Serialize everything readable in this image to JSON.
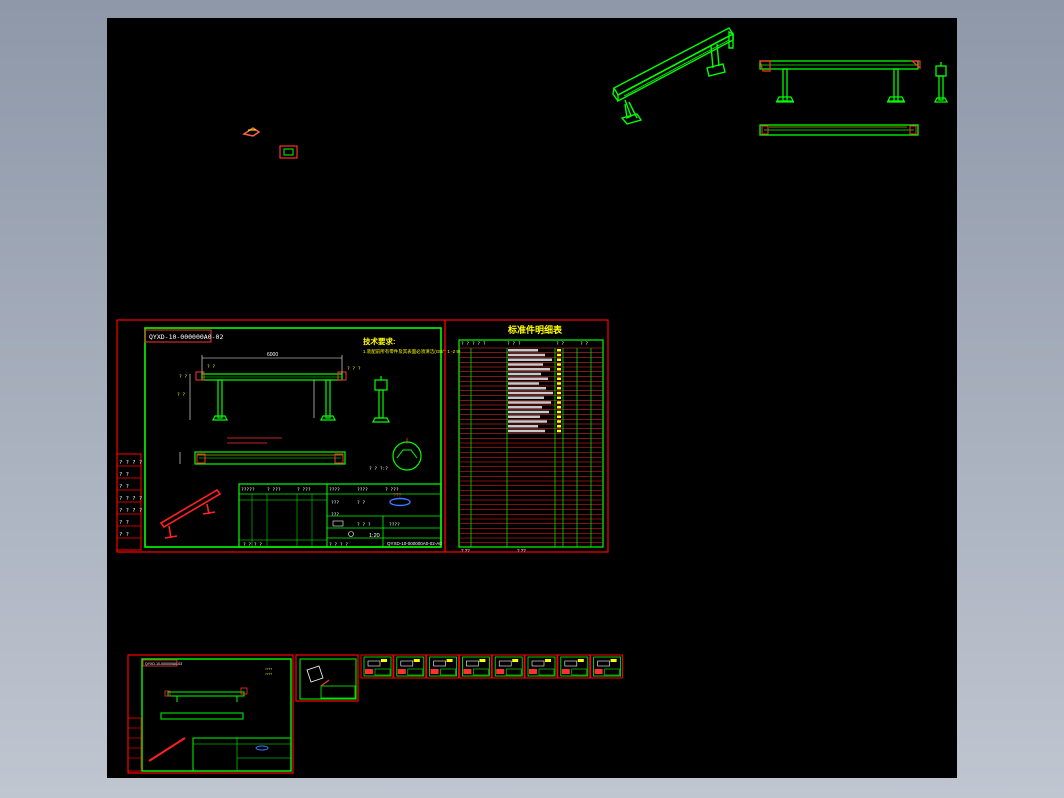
{
  "canvas": {
    "background": "#000000",
    "frame_color": "#ff0000",
    "border_color": "#00ff00",
    "text_color": "#ffff00",
    "accent_color": "#ff4040",
    "dim_color": "#ffffff"
  },
  "sheet_main": {
    "drawing_number": "QYXD-10-000000A0-02",
    "tech_req_title": "技术要求:",
    "tech_req_line": "1.装配前所有零件及其表面必须清洁(GB/T 1 -2 9)",
    "dimension_top": "6000",
    "title_block_code": "QYXD-10-000000A0-02-A0",
    "title_block_scale": "1:20",
    "title_block_codes": [
      "? ? ?",
      "? ?",
      "? ?",
      "? ? ?",
      "? ? ? ?",
      "? ? ? ?"
    ]
  },
  "sheet_parts": {
    "title": "标准件明细表",
    "header": [
      "? ?",
      "? ? ?",
      "? ? ?",
      "? ?",
      "? ?"
    ],
    "footer_left": "? ??",
    "footer_mid": "? ??"
  },
  "sheet_small": {
    "drawing_number": "QYXD-10-000000A0-03"
  }
}
